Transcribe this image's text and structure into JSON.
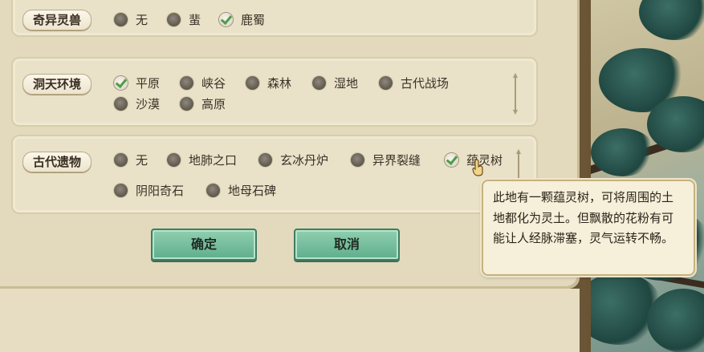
{
  "sections": [
    {
      "label": "奇异灵兽",
      "options": [
        {
          "text": "无",
          "checked": false
        },
        {
          "text": "蜚",
          "checked": false
        },
        {
          "text": "鹿蜀",
          "checked": true
        }
      ]
    },
    {
      "label": "洞天环境",
      "options": [
        {
          "text": "平原",
          "checked": true
        },
        {
          "text": "峡谷",
          "checked": false
        },
        {
          "text": "森林",
          "checked": false
        },
        {
          "text": "湿地",
          "checked": false
        },
        {
          "text": "古代战场",
          "checked": false
        },
        {
          "text": "沙漠",
          "checked": false
        },
        {
          "text": "高原",
          "checked": false
        }
      ]
    },
    {
      "label": "古代遗物",
      "options": [
        {
          "text": "无",
          "checked": false
        },
        {
          "text": "地肺之口",
          "checked": false
        },
        {
          "text": "玄冰丹炉",
          "checked": false
        },
        {
          "text": "异界裂缝",
          "checked": false
        },
        {
          "text": "蕴灵树",
          "checked": true
        },
        {
          "text": "阴阳奇石",
          "checked": false
        },
        {
          "text": "地母石碑",
          "checked": false
        }
      ]
    }
  ],
  "buttons": {
    "confirm": "确定",
    "cancel": "取消"
  },
  "tooltip": {
    "text": "此地有一颗蕴灵树，可将周围的土地都化为灵土。但飘散的花粉有可能让人经脉滞塞，灵气运转不畅。"
  },
  "colors": {
    "confirm_button": "#5fae8c",
    "check_mark": "#4f9b4e"
  }
}
